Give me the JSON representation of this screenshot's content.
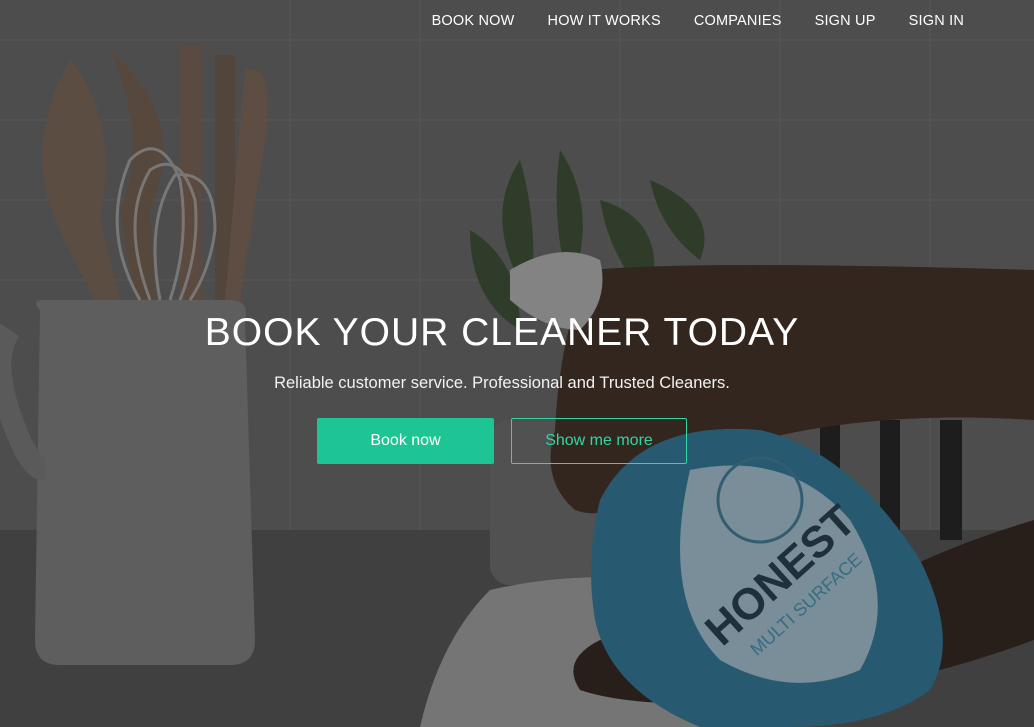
{
  "nav": {
    "items": [
      {
        "label": "BOOK NOW"
      },
      {
        "label": "HOW IT WORKS"
      },
      {
        "label": "COMPANIES"
      },
      {
        "label": "SIGN UP"
      },
      {
        "label": "SIGN IN"
      }
    ]
  },
  "hero": {
    "headline": "BOOK YOUR CLEANER TODAY",
    "subheadline": "Reliable customer service. Professional and Trusted Cleaners.",
    "primary_button": "Book now",
    "secondary_button": "Show me more"
  },
  "product": {
    "brand": "HONEST",
    "line": "MULTI SURFACE"
  },
  "colors": {
    "accent": "#1ec594",
    "accent_outline": "#2fd7a4",
    "text": "#ffffff"
  }
}
